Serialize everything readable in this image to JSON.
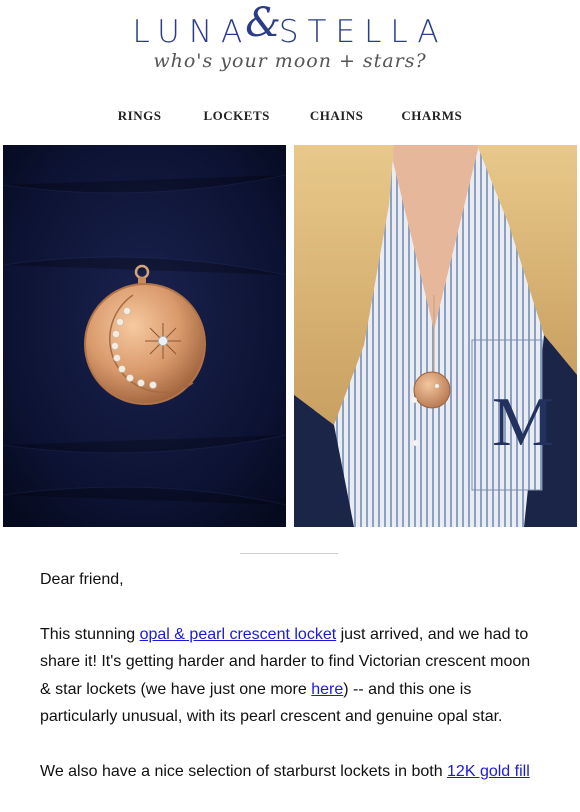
{
  "brand": {
    "logo_left": "LUNA",
    "logo_amp": "&",
    "logo_right": "STELLA",
    "tagline": "who's your moon + stars?"
  },
  "nav": {
    "items": [
      "RINGS",
      "LOCKETS",
      "CHAINS",
      "CHARMS"
    ]
  },
  "colors": {
    "brand_blue": "#2b3d86",
    "link": "#1a1ad8"
  },
  "body": {
    "greeting": "Dear friend,",
    "p1_a": "This stunning ",
    "p1_link1": "opal & pearl crescent locket",
    "p1_b": " just arrived, and we had to share it!  It's getting harder and harder to find Victorian crescent moon & star lockets (we have just one more ",
    "p1_link2": "here",
    "p1_c": ") -- and this one is particularly unusual, with its pearl crescent and genuine opal star.",
    "p2_a": "We also have a nice selection of starburst lockets in both ",
    "p2_link": "12K gold fill"
  }
}
